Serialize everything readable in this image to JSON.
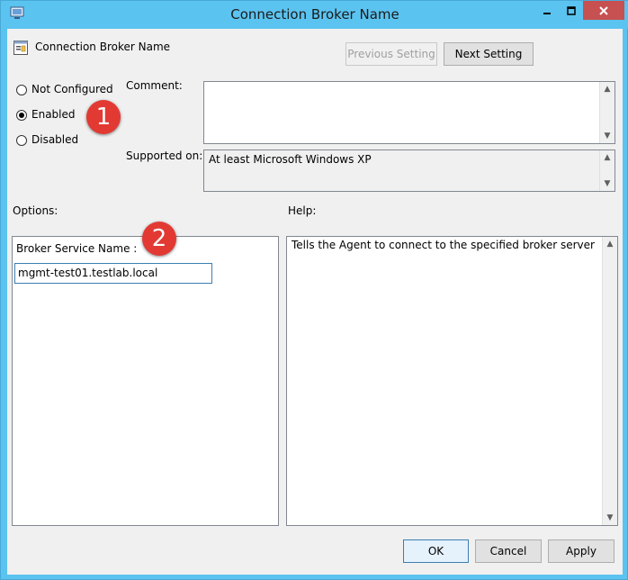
{
  "window": {
    "title": "Connection Broker Name"
  },
  "header": {
    "policy_name": "Connection Broker Name",
    "previous_label": "Previous Setting",
    "next_label": "Next Setting"
  },
  "state": {
    "options": [
      {
        "label": "Not Configured",
        "selected": false
      },
      {
        "label": "Enabled",
        "selected": true
      },
      {
        "label": "Disabled",
        "selected": false
      }
    ]
  },
  "comment": {
    "label": "Comment:",
    "value": ""
  },
  "supported": {
    "label": "Supported on:",
    "value": "At least Microsoft Windows XP"
  },
  "options_pane": {
    "label": "Options:",
    "field_label": "Broker Service Name :",
    "field_value": "mgmt-test01.testlab.local"
  },
  "help_pane": {
    "label": "Help:",
    "text": "Tells the Agent to connect to the specified broker server"
  },
  "annotations": {
    "badge1": "1",
    "badge2": "2"
  },
  "footer": {
    "ok_label": "OK",
    "cancel_label": "Cancel",
    "apply_label": "Apply"
  },
  "colors": {
    "titlebar": "#5bc3f0",
    "close_button": "#c75050",
    "badge": "#e23a33"
  }
}
